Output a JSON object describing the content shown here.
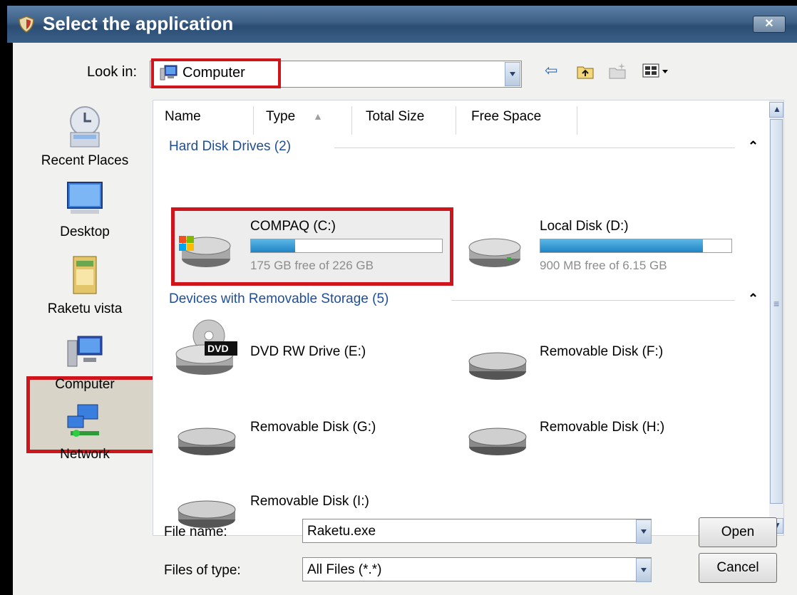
{
  "window": {
    "title": "Select the application",
    "close_label": "✕"
  },
  "toolbar": {
    "lookin_label": "Look in:",
    "lookin_value": "Computer",
    "icons": [
      "back-arrow-icon",
      "up-folder-icon",
      "new-folder-icon",
      "views-menu-icon"
    ]
  },
  "places": [
    {
      "label": "Recent Places",
      "icon": "recent-places-icon"
    },
    {
      "label": "Desktop",
      "icon": "desktop-icon"
    },
    {
      "label": "Raketu vista",
      "icon": "folder-icon"
    },
    {
      "label": "Computer",
      "icon": "computer-icon",
      "selected": true
    },
    {
      "label": "Network",
      "icon": "network-icon"
    }
  ],
  "columns": [
    "Name",
    "Type",
    "Total Size",
    "Free Space"
  ],
  "groups": [
    {
      "title": "Hard Disk Drives (2)"
    },
    {
      "title": "Devices with Removable Storage (5)"
    }
  ],
  "hard_drives": [
    {
      "name": "COMPAQ (C:)",
      "free_text": "175 GB free of 226 GB",
      "used_fraction": 0.23,
      "selected": true
    },
    {
      "name": "Local Disk (D:)",
      "free_text": "900 MB free of 6.15 GB",
      "used_fraction": 0.85
    }
  ],
  "removable": [
    {
      "name": "DVD RW Drive (E:)",
      "icon": "dvd-drive-icon",
      "badge": "DVD"
    },
    {
      "name": "Removable Disk (F:)",
      "icon": "removable-disk-icon"
    },
    {
      "name": "Removable Disk (G:)",
      "icon": "removable-disk-icon"
    },
    {
      "name": "Removable Disk (H:)",
      "icon": "removable-disk-icon"
    },
    {
      "name": "Removable Disk (I:)",
      "icon": "removable-disk-icon"
    }
  ],
  "footer": {
    "file_name_label": "File name:",
    "file_name_value": "Raketu.exe",
    "file_type_label": "Files of type:",
    "file_type_value": "All Files (*.*)",
    "open_label": "Open",
    "cancel_label": "Cancel"
  },
  "colors": {
    "highlight": "#d0141c",
    "title_bar": "#3d5f86",
    "group_text": "#1e4e9a"
  }
}
